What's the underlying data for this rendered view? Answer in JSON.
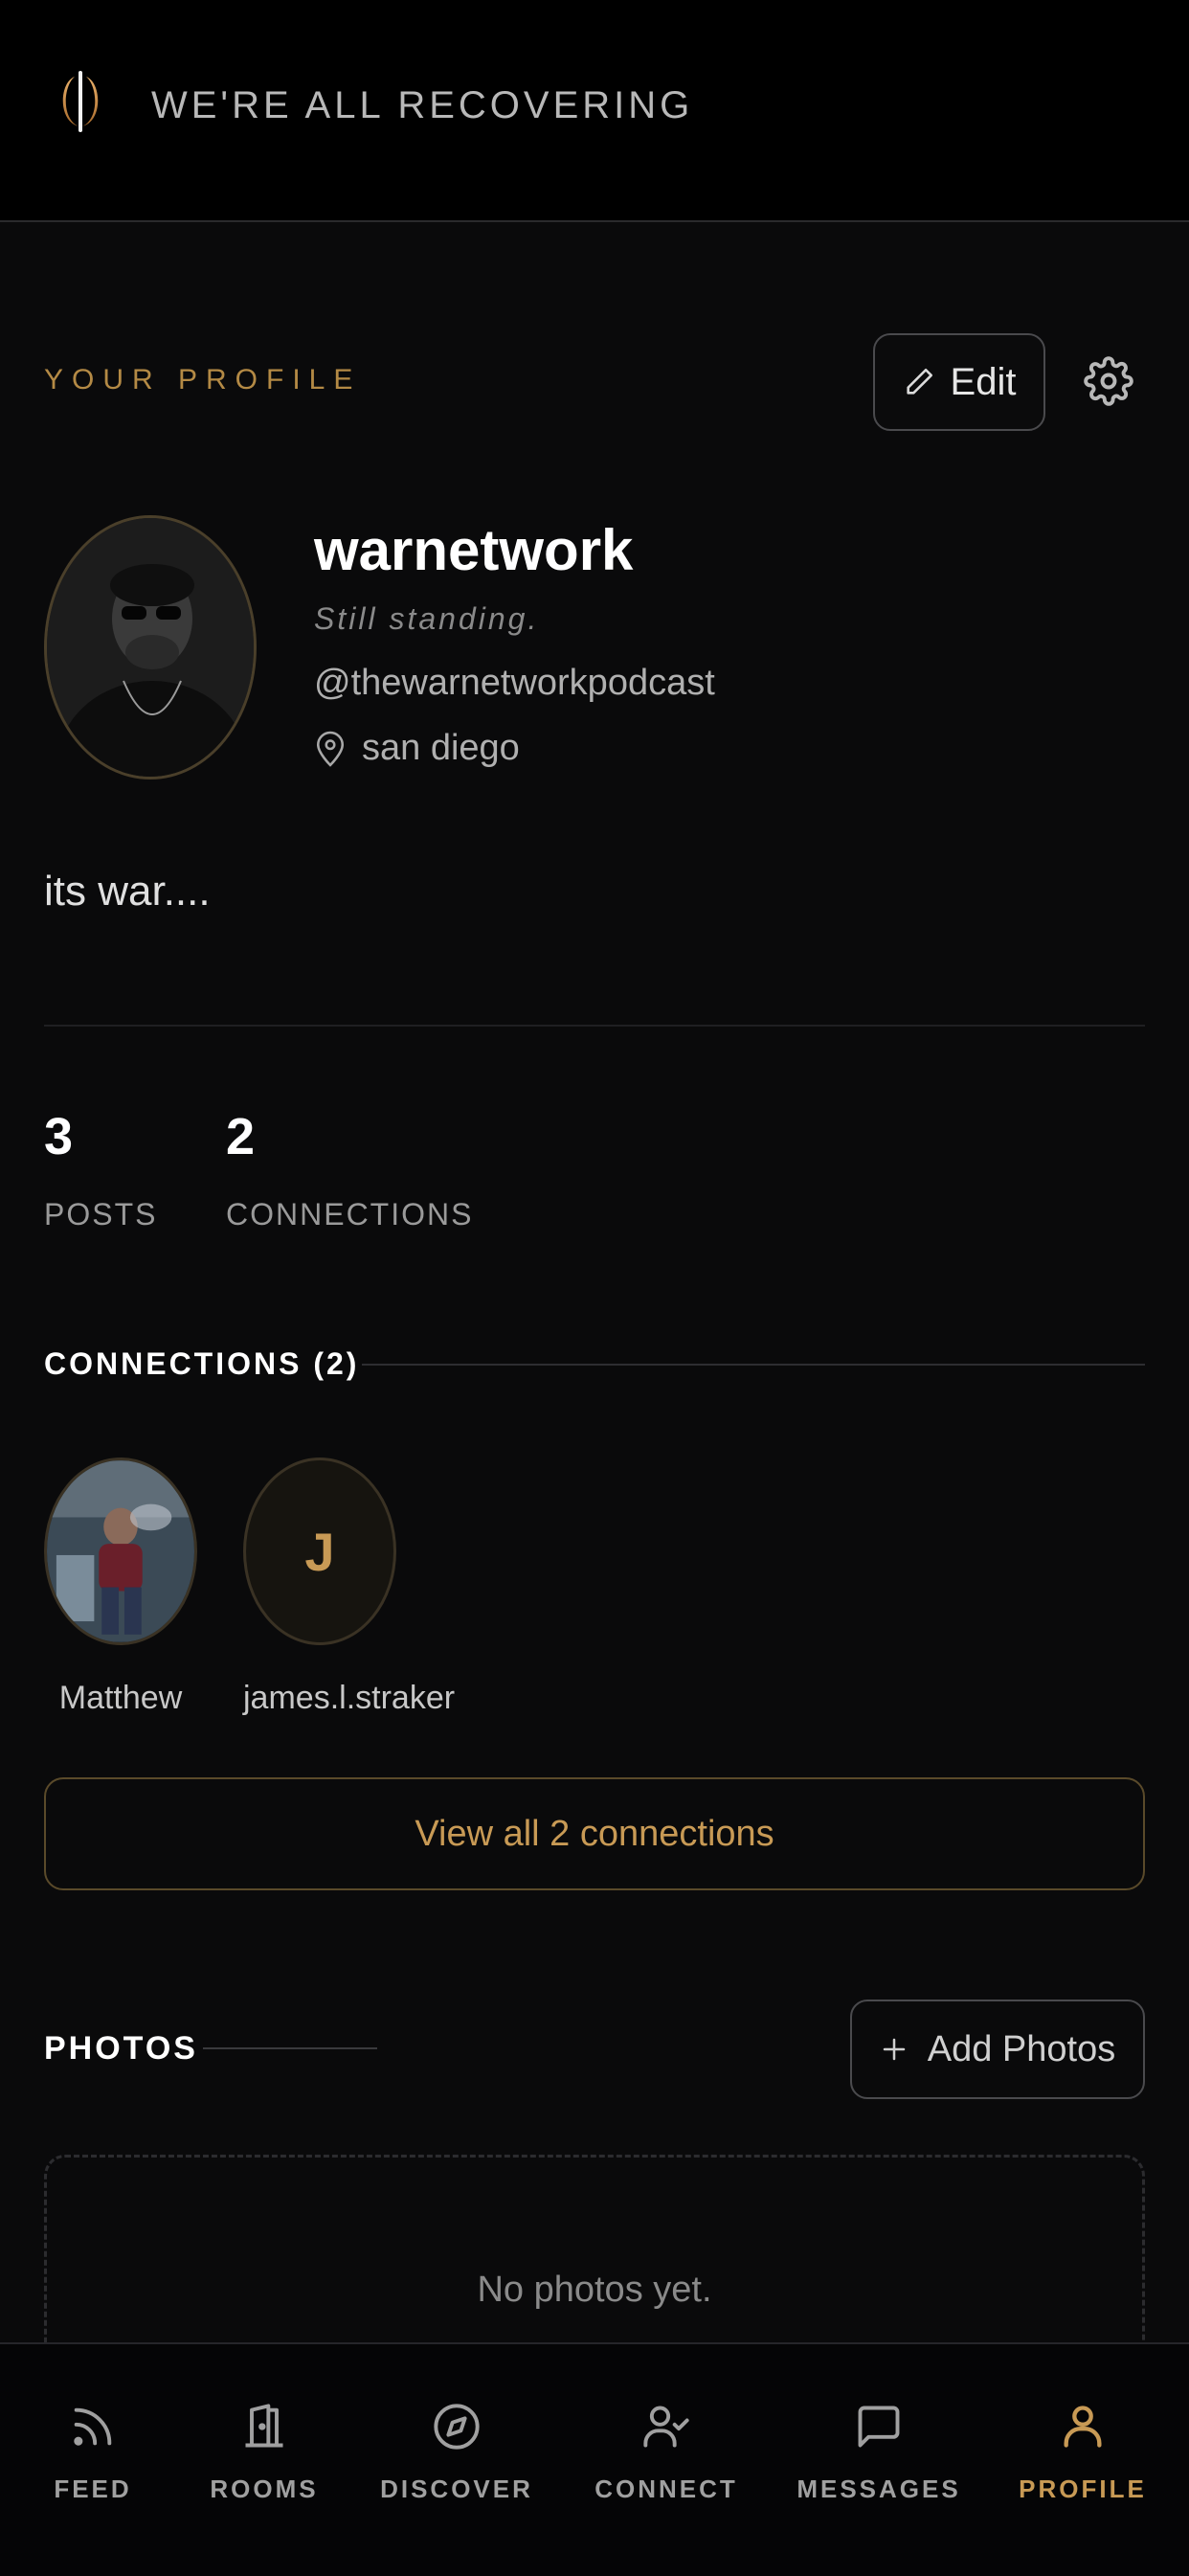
{
  "header": {
    "app_title": "WE'RE ALL RECOVERING"
  },
  "profile": {
    "section_label": "YOUR PROFILE",
    "edit_label": "Edit",
    "display_name": "warnetwork",
    "tagline": "Still standing.",
    "handle": "@thewarnetworkpodcast",
    "location": "san diego",
    "bio": "its war...."
  },
  "stats": [
    {
      "value": "3",
      "label": "POSTS"
    },
    {
      "value": "2",
      "label": "CONNECTIONS"
    }
  ],
  "connections": {
    "title": "CONNECTIONS (2)",
    "items": [
      {
        "name": "Matthew",
        "initial": ""
      },
      {
        "name": "james.l.straker",
        "initial": "J"
      }
    ],
    "view_all_label": "View all 2 connections"
  },
  "photos": {
    "title": "PHOTOS",
    "add_label": "Add Photos",
    "empty_text": "No photos yet."
  },
  "tabs": [
    {
      "label": "FEED",
      "icon": "rss-icon"
    },
    {
      "label": "ROOMS",
      "icon": "door-icon"
    },
    {
      "label": "DISCOVER",
      "icon": "compass-icon"
    },
    {
      "label": "CONNECT",
      "icon": "user-check-icon"
    },
    {
      "label": "MESSAGES",
      "icon": "message-square-icon"
    },
    {
      "label": "PROFILE",
      "icon": "user-icon",
      "active": true
    }
  ],
  "colors": {
    "accent": "#c89a55",
    "background": "#0a0a0b",
    "header": "#000000"
  }
}
